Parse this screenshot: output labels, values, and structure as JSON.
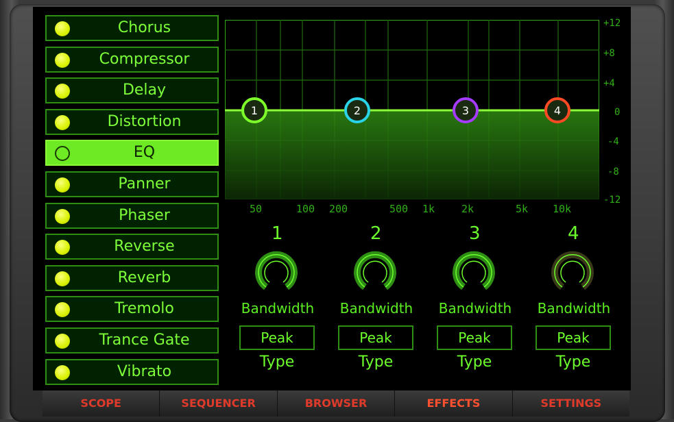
{
  "effects": [
    {
      "label": "Chorus",
      "selected": false
    },
    {
      "label": "Compressor",
      "selected": false
    },
    {
      "label": "Delay",
      "selected": false
    },
    {
      "label": "Distortion",
      "selected": false
    },
    {
      "label": "EQ",
      "selected": true
    },
    {
      "label": "Panner",
      "selected": false
    },
    {
      "label": "Phaser",
      "selected": false
    },
    {
      "label": "Reverse",
      "selected": false
    },
    {
      "label": "Reverb",
      "selected": false
    },
    {
      "label": "Tremolo",
      "selected": false
    },
    {
      "label": "Trance Gate",
      "selected": false
    },
    {
      "label": "Vibrato",
      "selected": false
    }
  ],
  "eq": {
    "db_labels": [
      "+12",
      "+8",
      "+4",
      "0",
      "-4",
      "-8",
      "-12"
    ],
    "freq_labels": [
      "50",
      "100",
      "200",
      "500",
      "1k",
      "2k",
      "5k",
      "10k"
    ],
    "nodes": [
      {
        "num": "1",
        "color": "#7dff2a"
      },
      {
        "num": "2",
        "color": "#29d3e8"
      },
      {
        "num": "3",
        "color": "#a43bff"
      },
      {
        "num": "4",
        "color": "#ff4a24"
      }
    ]
  },
  "bands": [
    {
      "num": "1",
      "knob_label": "Bandwidth",
      "type_value": "Peak",
      "type_label": "Type"
    },
    {
      "num": "2",
      "knob_label": "Bandwidth",
      "type_value": "Peak",
      "type_label": "Type"
    },
    {
      "num": "3",
      "knob_label": "Bandwidth",
      "type_value": "Peak",
      "type_label": "Type"
    },
    {
      "num": "4",
      "knob_label": "Bandwidth",
      "type_value": "Peak",
      "type_label": "Type"
    }
  ],
  "tabs": [
    {
      "label": "SCOPE",
      "active": false
    },
    {
      "label": "SEQUENCER",
      "active": false
    },
    {
      "label": "BROWSER",
      "active": false
    },
    {
      "label": "EFFECTS",
      "active": true
    },
    {
      "label": "SETTINGS",
      "active": false
    }
  ]
}
